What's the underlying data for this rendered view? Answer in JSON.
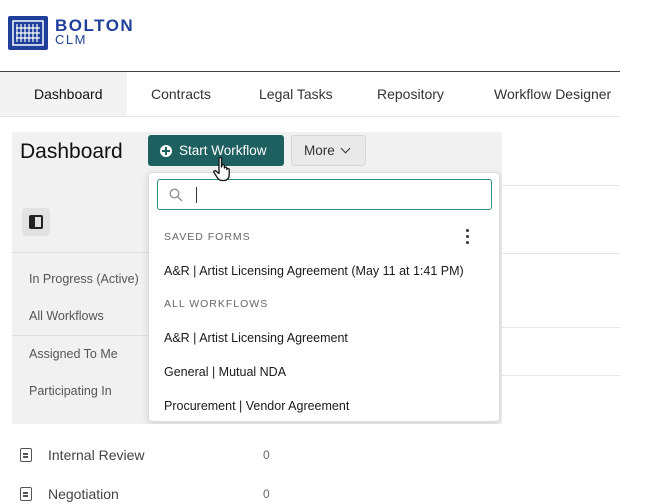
{
  "brand": {
    "line1": "BOLTON",
    "line2": "CLM",
    "color": "#1f3f9a"
  },
  "nav": {
    "tabs": [
      {
        "label": "Dashboard",
        "active": true
      },
      {
        "label": "Contracts",
        "active": false
      },
      {
        "label": "Legal Tasks",
        "active": false
      },
      {
        "label": "Repository",
        "active": false
      },
      {
        "label": "Workflow Designer",
        "active": false
      }
    ]
  },
  "panel": {
    "title": "Dashboard",
    "start_workflow_label": "Start Workflow",
    "more_label": "More",
    "accent": "#1e5f5f",
    "sidebar_items": [
      "In Progress (Active)",
      "All Workflows",
      "Assigned To Me",
      "Participating In"
    ]
  },
  "dropdown": {
    "search": {
      "placeholder": "",
      "value": ""
    },
    "saved_forms_label": "SAVED FORMS",
    "saved_forms": [
      "A&R | Artist Licensing Agreement (May 11 at 1:41 PM)"
    ],
    "all_workflows_label": "ALL WORKFLOWS",
    "workflows": [
      "A&R | Artist Licensing Agreement",
      "General | Mutual NDA",
      "Procurement | Vendor Agreement"
    ]
  },
  "background_rows": [
    {
      "label": "Internal Review",
      "count": "0"
    },
    {
      "label": "Negotiation",
      "count": "0"
    }
  ]
}
